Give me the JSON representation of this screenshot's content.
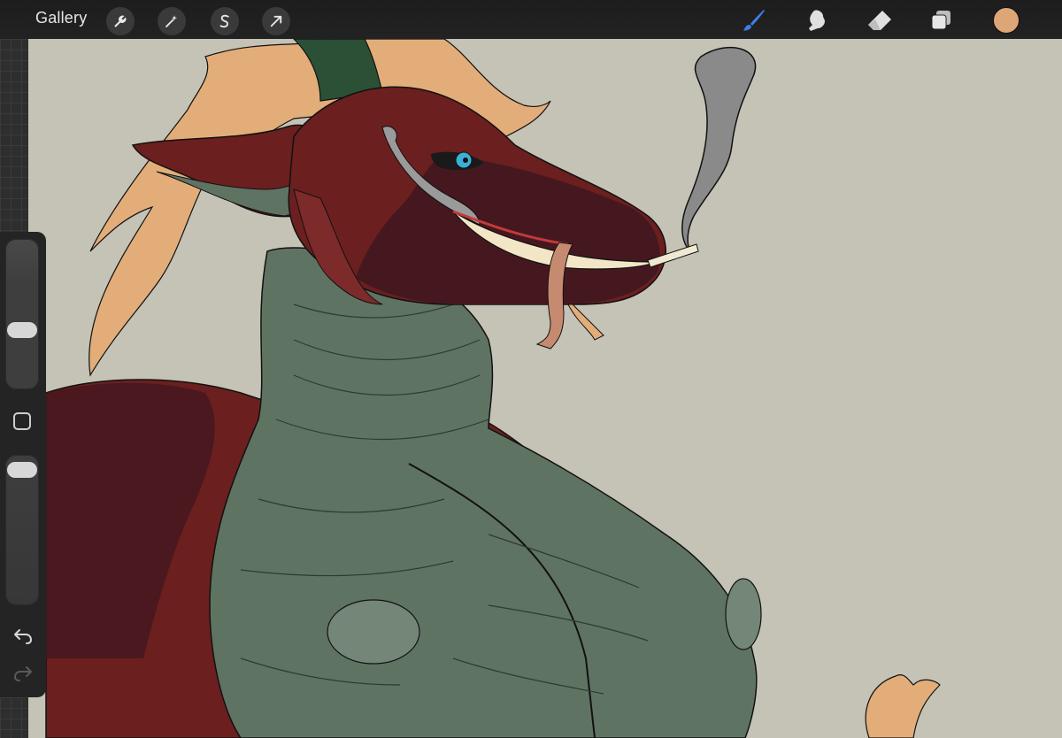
{
  "toolbar": {
    "gallery_label": "Gallery",
    "left_tools": [
      {
        "name": "actions-wrench-icon"
      },
      {
        "name": "adjustments-magic-wand-icon"
      },
      {
        "name": "selection-s-icon"
      },
      {
        "name": "transform-arrow-icon"
      }
    ],
    "right_tools": [
      {
        "name": "brush-icon",
        "active": true
      },
      {
        "name": "smudge-icon",
        "active": false
      },
      {
        "name": "eraser-icon",
        "active": false
      },
      {
        "name": "layers-icon",
        "active": false
      }
    ],
    "current_color": "#dea677"
  },
  "sidebar": {
    "brush_size_level": 0.62,
    "opacity_level": 0.04,
    "modify_icon": "square-outline-icon",
    "undo_icon": "undo-arrow-icon",
    "redo_icon": "redo-arrow-icon"
  },
  "canvas": {
    "background_color": "#c5c2b6",
    "colors": {
      "skin_red": "#6b1f1f",
      "skin_dark": "#451820",
      "belly_green": "#5f7362",
      "belly_light": "#738677",
      "mane": "#e3ad7a",
      "horn": "#2b5036",
      "smoke": "#8a8a8a",
      "eye": "#3ab0d6"
    }
  }
}
